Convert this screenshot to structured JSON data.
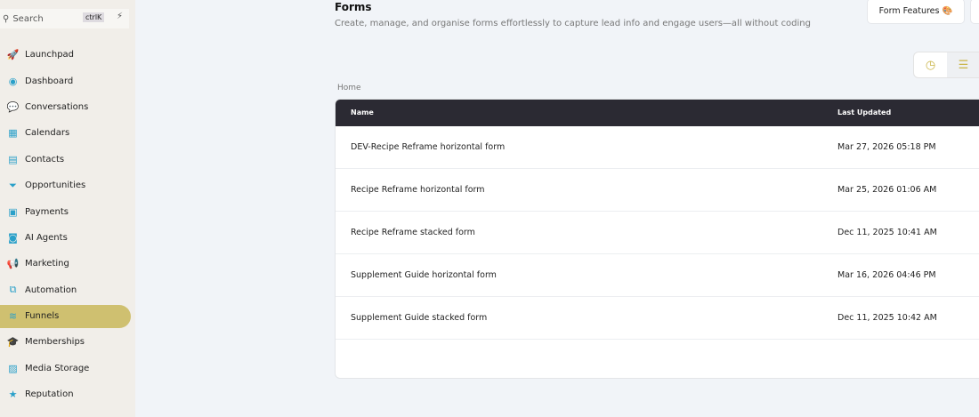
{
  "sidebar": {
    "search_placeholder": "Search",
    "shortcut": "ctrlK",
    "items": [
      {
        "label": "Launchpad",
        "icon": "rocket-icon"
      },
      {
        "label": "Dashboard",
        "icon": "dashboard-icon"
      },
      {
        "label": "Conversations",
        "icon": "chat-icon"
      },
      {
        "label": "Calendars",
        "icon": "calendar-icon"
      },
      {
        "label": "Contacts",
        "icon": "contact-card-icon"
      },
      {
        "label": "Opportunities",
        "icon": "funnel-filter-icon"
      },
      {
        "label": "Payments",
        "icon": "payments-icon"
      },
      {
        "label": "AI Agents",
        "icon": "robot-icon"
      },
      {
        "label": "Marketing",
        "icon": "megaphone-icon"
      },
      {
        "label": "Automation",
        "icon": "workflow-icon"
      },
      {
        "label": "Funnels",
        "icon": "layers-icon",
        "active": true
      },
      {
        "label": "Memberships",
        "icon": "graduation-cap-icon"
      },
      {
        "label": "Media Storage",
        "icon": "media-icon"
      },
      {
        "label": "Reputation",
        "icon": "star-icon"
      }
    ]
  },
  "header": {
    "title": "Forms",
    "subtitle": "Create, manage, and organise forms effortlessly to capture lead info and engage users—all without coding",
    "features_button": "Form Features"
  },
  "breadcrumb": "Home",
  "table": {
    "columns": [
      "Name",
      "Last Updated"
    ],
    "rows": [
      {
        "name": "DEV-Recipe Reframe horizontal form",
        "updated": "Mar 27, 2026 05:18 PM"
      },
      {
        "name": "Recipe Reframe horizontal form",
        "updated": "Mar 25, 2026 01:06 AM"
      },
      {
        "name": "Recipe Reframe stacked form",
        "updated": "Dec 11, 2025 10:41 AM"
      },
      {
        "name": "Supplement Guide horizontal form",
        "updated": "Mar 16, 2026 04:46 PM"
      },
      {
        "name": "Supplement Guide stacked form",
        "updated": "Dec 11, 2025 10:42 AM"
      }
    ]
  }
}
